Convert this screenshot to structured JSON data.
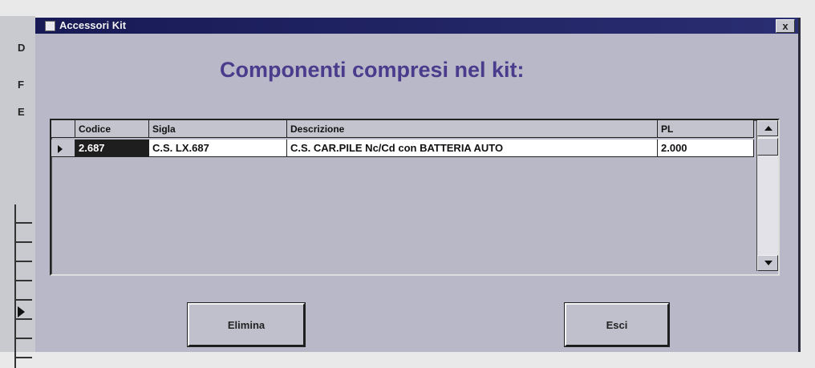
{
  "background_app": {
    "side_letters": [
      "D",
      "F",
      "E"
    ]
  },
  "dialog": {
    "title": "Accessori Kit",
    "close_label": "x",
    "heading": "Componenti compresi nel kit:"
  },
  "grid": {
    "columns": [
      "Codice",
      "Sigla",
      "Descrizione",
      "PL"
    ],
    "rows": [
      {
        "codice": "2.687",
        "sigla": "C.S. LX.687",
        "descrizione": "C.S. CAR.PILE Nc/Cd con BATTERIA AUTO",
        "pl": "2.000"
      }
    ]
  },
  "buttons": {
    "elimina": "Elimina",
    "esci": "Esci"
  },
  "colors": {
    "titlebar": "#181a55",
    "dialog_bg": "#b8b8c9",
    "heading": "#4b3b8c"
  }
}
